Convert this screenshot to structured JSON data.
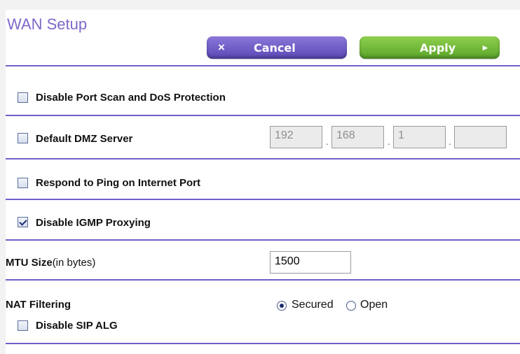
{
  "title": "WAN Setup",
  "buttons": {
    "cancel_glyph": "×",
    "cancel_label": "Cancel",
    "apply_label": "Apply",
    "apply_glyph": "▸"
  },
  "options": {
    "port_scan": {
      "label": "Disable Port Scan and DoS Protection",
      "checked": false
    },
    "dmz": {
      "label": "Default DMZ Server",
      "checked": false,
      "ip": [
        "192",
        "168",
        "1",
        ""
      ],
      "separator": "."
    },
    "ping": {
      "label": "Respond to Ping on Internet Port",
      "checked": false
    },
    "igmp": {
      "label": "Disable IGMP Proxying",
      "checked": true
    },
    "mtu": {
      "label": "MTU Size",
      "hint": "(in bytes)",
      "value": "1500"
    },
    "nat": {
      "label": "NAT Filtering",
      "secured_label": "Secured",
      "open_label": "Open",
      "selected": "Secured"
    },
    "sip": {
      "label": "Disable SIP ALG",
      "checked": false
    }
  }
}
